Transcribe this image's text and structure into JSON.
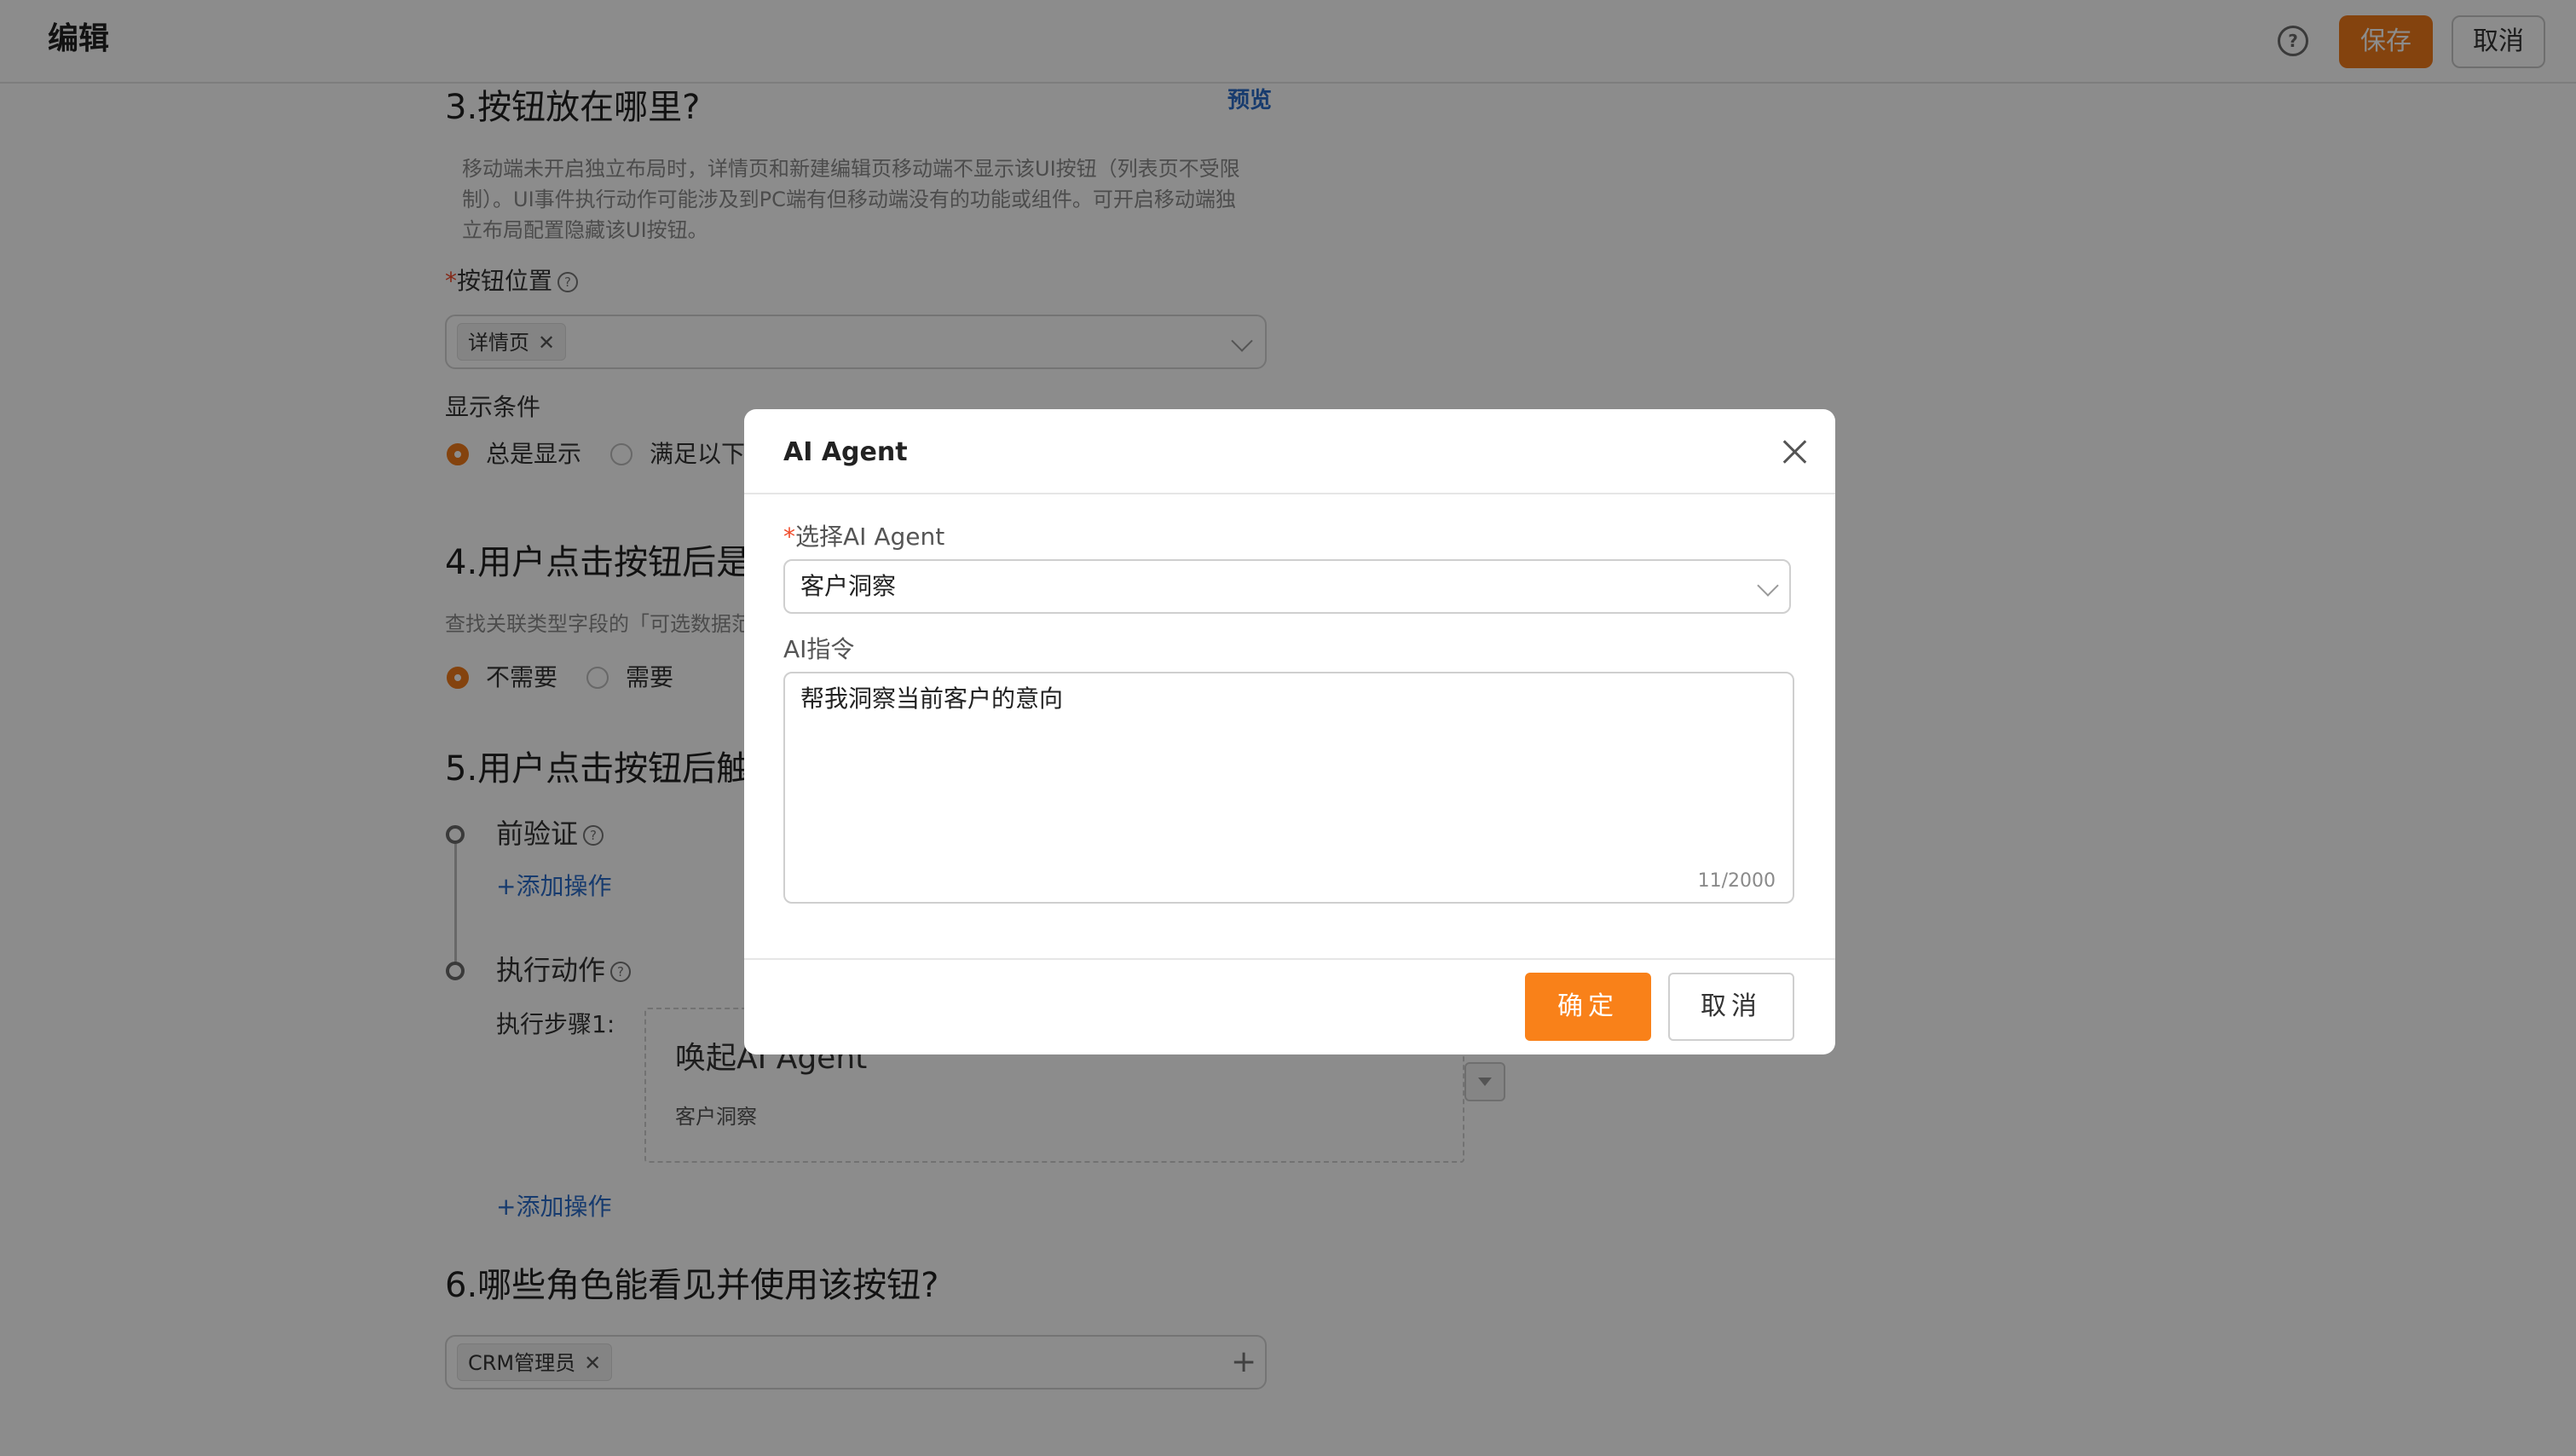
{
  "header": {
    "title": "编辑",
    "help_icon": "help-circle-icon",
    "save_label": "保存",
    "cancel_label": "取消"
  },
  "section3": {
    "title": "3.按钮放在哪里?",
    "preview_link": "预览",
    "desc_line1": "移动端未开启独立布局时，详情页和新建编辑页移动端不显示该UI按钮（列表页不受限",
    "desc_line2": "制）。UI事件执行动作可能涉及到PC端有但移动端没有的功能或组件。可开启移动端独",
    "desc_line3": "立布局配置隐藏该UI按钮。",
    "position_required": "*",
    "position_label": "按钮位置",
    "position_tag": "详情页",
    "display_label": "显示条件",
    "display_opt_always": "总是显示",
    "display_opt_conditional": "满足以下"
  },
  "section4": {
    "title": "4.用户点击按钮后是",
    "desc": "查找关联类型字段的「可选数据范",
    "opt_no": "不需要",
    "opt_yes": "需要"
  },
  "section5": {
    "title": "5.用户点击按钮后触",
    "pre_validate": "前验证",
    "add_action_1": "+添加操作",
    "execute_action": "执行动作",
    "step_label": "执行步骤1:",
    "card_title": "唤起AI Agent",
    "card_sub": "客户洞察",
    "add_action_2": "+添加操作"
  },
  "section6": {
    "title": "6.哪些角色能看见并使用该按钮?",
    "role_tag": "CRM管理员"
  },
  "modal": {
    "title": "AI Agent",
    "agent_required": "*",
    "agent_label": "选择AI Agent",
    "agent_value": "客户洞察",
    "instruction_label": "AI指令",
    "instruction_value": "帮我洞察当前客户的意向",
    "counter": "11/2000",
    "ok_label": "确定",
    "cancel_label": "取消"
  },
  "colors": {
    "accent": "#f07b1b",
    "ok_button": "#f98119",
    "link": "#2a6cc8",
    "required": "#f04a2a"
  }
}
